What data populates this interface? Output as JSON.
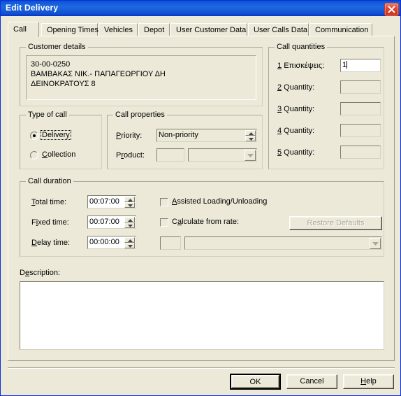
{
  "window": {
    "title": "Edit Delivery",
    "close_icon": "close-icon",
    "accent_titlebar": "#1f68e0",
    "dialog_bg": "#ece9d8",
    "frame_color": "#0831d9"
  },
  "tabs": [
    {
      "label": "Call",
      "active": true
    },
    {
      "label": "Opening Times",
      "active": false
    },
    {
      "label": "Vehicles",
      "active": false
    },
    {
      "label": "Depot",
      "active": false
    },
    {
      "label": "User Customer Data",
      "active": false
    },
    {
      "label": "User Calls Data",
      "active": false
    },
    {
      "label": "Communication",
      "active": false
    }
  ],
  "customer_details": {
    "caption": "Customer details",
    "line1": "30-00-0250",
    "line2": "ΒΑΜΒΑΚΑΣ ΝΙΚ.- ΠΑΠΑΓΕΩΡΓΙΟΥ ΔΗ",
    "line3": "ΔΕΙΝΟΚΡΑΤΟΥΣ 8"
  },
  "call_quantities": {
    "caption": "Call quantities",
    "rows": [
      {
        "label": "1 Επισκέψεις:",
        "value": "1",
        "enabled": true
      },
      {
        "label": "2 Quantity:",
        "value": "",
        "enabled": false
      },
      {
        "label": "3 Quantity:",
        "value": "",
        "enabled": false
      },
      {
        "label": "4 Quantity:",
        "value": "",
        "enabled": false
      },
      {
        "label": "5 Quantity:",
        "value": "",
        "enabled": false
      }
    ]
  },
  "type_of_call": {
    "caption": "Type of call",
    "options": [
      {
        "label": "Delivery",
        "selected": true,
        "focused": true
      },
      {
        "label": "Collection",
        "selected": false,
        "focused": false
      }
    ]
  },
  "call_properties": {
    "caption": "Call properties",
    "priority_label": "Priority:",
    "priority_value": "Non-priority",
    "product_label": "Product:",
    "product_code": "",
    "product_value": ""
  },
  "call_duration": {
    "caption": "Call duration",
    "total_label": "Total time:",
    "total_value": "00:07:00",
    "fixed_label": "Fixed time:",
    "fixed_value": "00:07:00",
    "delay_label": "Delay time:",
    "delay_value": "00:00:00",
    "assisted_label": "Assisted Loading/Unloading",
    "assisted_checked": false,
    "calcrate_label": "Calculate from rate:",
    "calcrate_checked": false,
    "rate_code": "",
    "rate_value": "",
    "restore_label": "Restore Defaults",
    "restore_enabled": false
  },
  "description": {
    "label": "Description:",
    "value": ""
  },
  "footer": {
    "ok_label": "OK",
    "cancel_label": "Cancel",
    "help_label": "Help"
  }
}
